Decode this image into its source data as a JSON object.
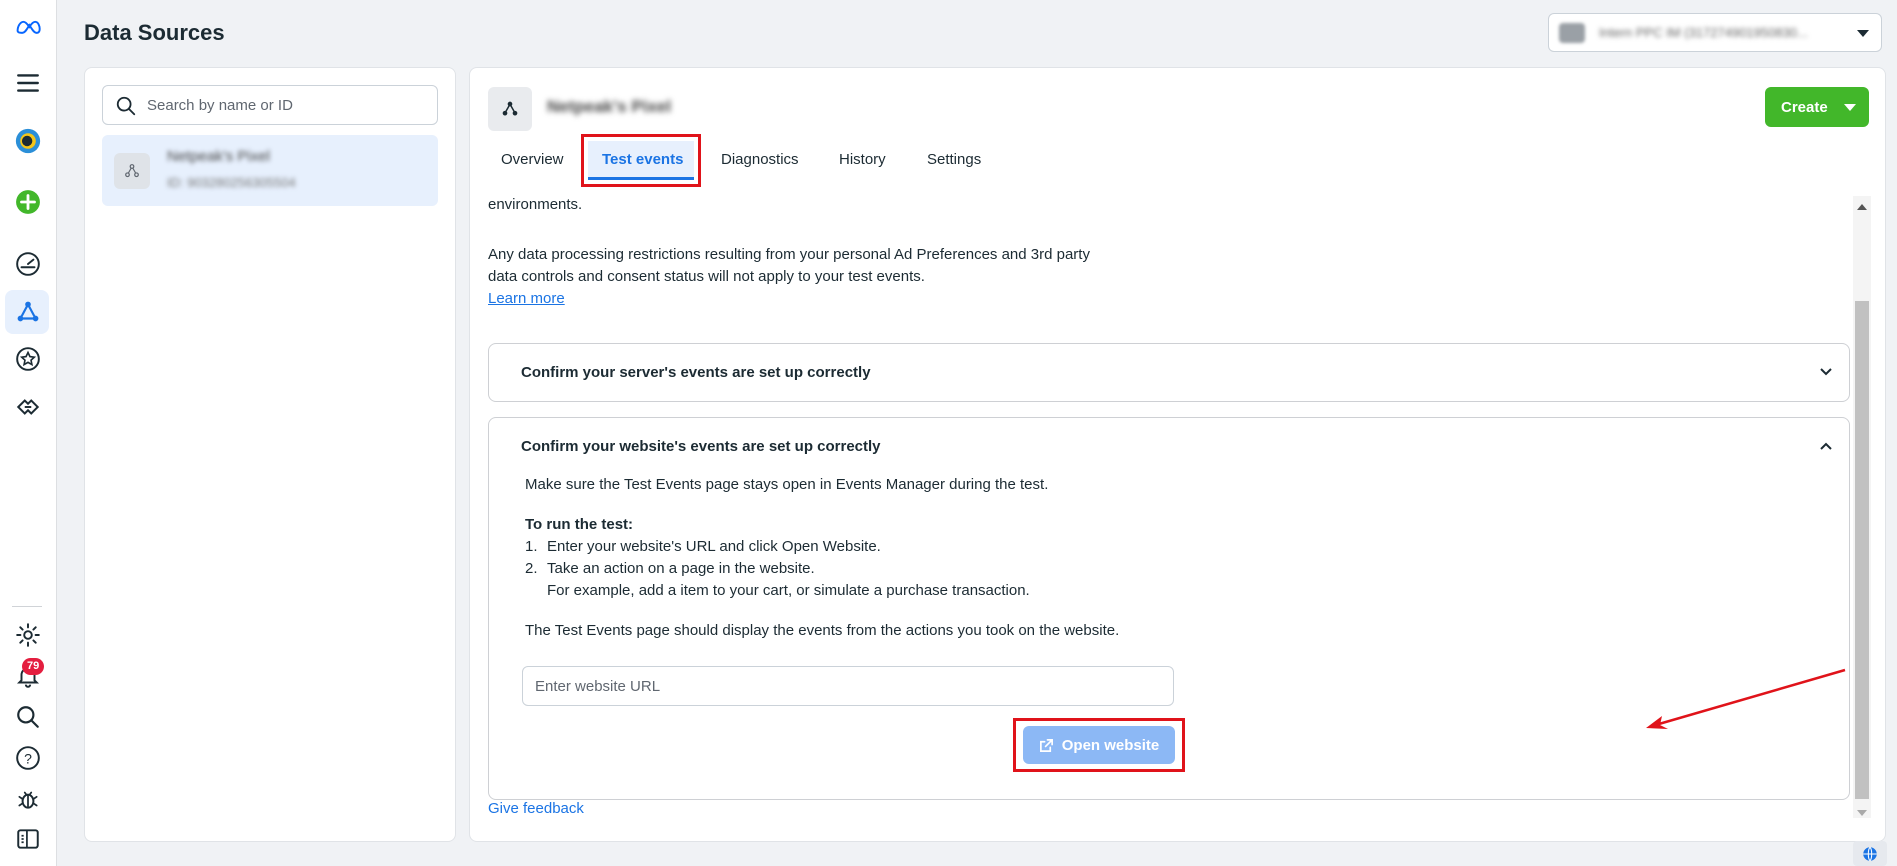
{
  "app": {
    "title": "Data Sources",
    "account_label": "Intern PPC IM (317274901950830..."
  },
  "rail": {
    "notification_count": "79"
  },
  "sidebar": {
    "search_placeholder": "Search by name or ID",
    "sources": [
      {
        "name": "Netpeak's Pixel",
        "id": "ID: 903280256305504"
      }
    ]
  },
  "main": {
    "pixel_name": "Netpeak's Pixel",
    "create_label": "Create",
    "tabs": [
      {
        "label": "Overview"
      },
      {
        "label": "Test events",
        "active": true
      },
      {
        "label": "Diagnostics"
      },
      {
        "label": "History"
      },
      {
        "label": "Settings"
      }
    ],
    "intro_tail": "environments.",
    "restrictions_line1": "Any data processing restrictions resulting from your personal Ad Preferences and 3rd party",
    "restrictions_line2": "data controls and consent status will not apply to your test events.",
    "learn_more": "Learn more",
    "server_section_title": "Confirm your server's events are set up correctly",
    "website_section": {
      "title": "Confirm your website's events are set up correctly",
      "keep_open": "Make sure the Test Events page stays open in Events Manager during the test.",
      "run_heading": "To run the test:",
      "step1_num": "1.",
      "step1": "Enter your website's URL and click Open Website.",
      "step2_num": "2.",
      "step2": "Take an action on a page in the website.",
      "step2_example": "For example, add a item to your cart, or simulate a purchase transaction.",
      "display_note": "The Test Events page should display the events from the actions you took on the website.",
      "url_placeholder": "Enter website URL",
      "open_label": "Open website"
    },
    "give_feedback": "Give feedback"
  },
  "colors": {
    "accent": "#1b74e4",
    "create_green": "#42b72a",
    "highlight_red": "#e0131a",
    "open_button_disabled": "#8cb8f5"
  }
}
